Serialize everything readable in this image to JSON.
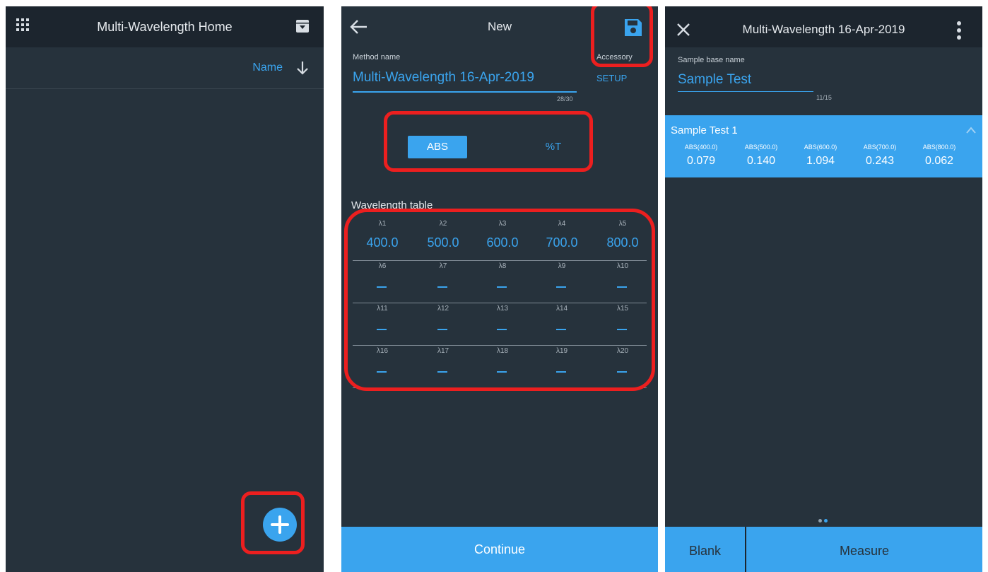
{
  "colors": {
    "panel_bg": "#26323c",
    "topbar_bg": "#1c252e",
    "accent": "#3aa4ee",
    "highlight": "#ec1f1f",
    "white_bg": "#ffffff"
  },
  "home": {
    "title": "Multi-Wavelength Home",
    "menu_icon": "apps-grid-icon",
    "archive_icon": "archive-box-icon",
    "sort_label": "Name",
    "sort_icon": "arrow-down-icon",
    "fab_icon": "plus-icon"
  },
  "new_method": {
    "back_icon": "arrow-left-icon",
    "title": "New",
    "save_icon": "floppy-disk-icon",
    "method_name_label": "Method name",
    "method_name_value": "Multi-Wavelength 16-Apr-2019",
    "char_count": "28/30",
    "accessory_label": "Accessory",
    "setup_button": "SETUP",
    "mode_abs": "ABS",
    "mode_t": "%T",
    "wavelength_table_title": "Wavelength table",
    "wavelengths": [
      {
        "name": "λ1",
        "value": "400.0"
      },
      {
        "name": "λ2",
        "value": "500.0"
      },
      {
        "name": "λ3",
        "value": "600.0"
      },
      {
        "name": "λ4",
        "value": "700.0"
      },
      {
        "name": "λ5",
        "value": "800.0"
      },
      {
        "name": "λ6",
        "value": ""
      },
      {
        "name": "λ7",
        "value": ""
      },
      {
        "name": "λ8",
        "value": ""
      },
      {
        "name": "λ9",
        "value": ""
      },
      {
        "name": "λ10",
        "value": ""
      },
      {
        "name": "λ11",
        "value": ""
      },
      {
        "name": "λ12",
        "value": ""
      },
      {
        "name": "λ13",
        "value": ""
      },
      {
        "name": "λ14",
        "value": ""
      },
      {
        "name": "λ15",
        "value": ""
      },
      {
        "name": "λ16",
        "value": ""
      },
      {
        "name": "λ17",
        "value": ""
      },
      {
        "name": "λ18",
        "value": ""
      },
      {
        "name": "λ19",
        "value": ""
      },
      {
        "name": "λ20",
        "value": ""
      }
    ],
    "continue_button": "Continue"
  },
  "measure": {
    "close_icon": "close-x-icon",
    "title": "Multi-Wavelength 16-Apr-2019",
    "more_icon": "more-vertical-icon",
    "sample_base_label": "Sample base name",
    "sample_base_value": "Sample Test",
    "char_count": "11/15",
    "sample_card": {
      "name": "Sample Test 1",
      "collapse_icon": "chevron-up-icon",
      "columns": [
        {
          "label": "ABS(400.0)",
          "value": "0.079"
        },
        {
          "label": "ABS(500.0)",
          "value": "0.140"
        },
        {
          "label": "ABS(600.0)",
          "value": "1.094"
        },
        {
          "label": "ABS(700.0)",
          "value": "0.243"
        },
        {
          "label": "ABS(800.0)",
          "value": "0.062"
        }
      ]
    },
    "page_indicator": {
      "pages": 2,
      "active": 2
    },
    "blank_button": "Blank",
    "measure_button": "Measure"
  }
}
